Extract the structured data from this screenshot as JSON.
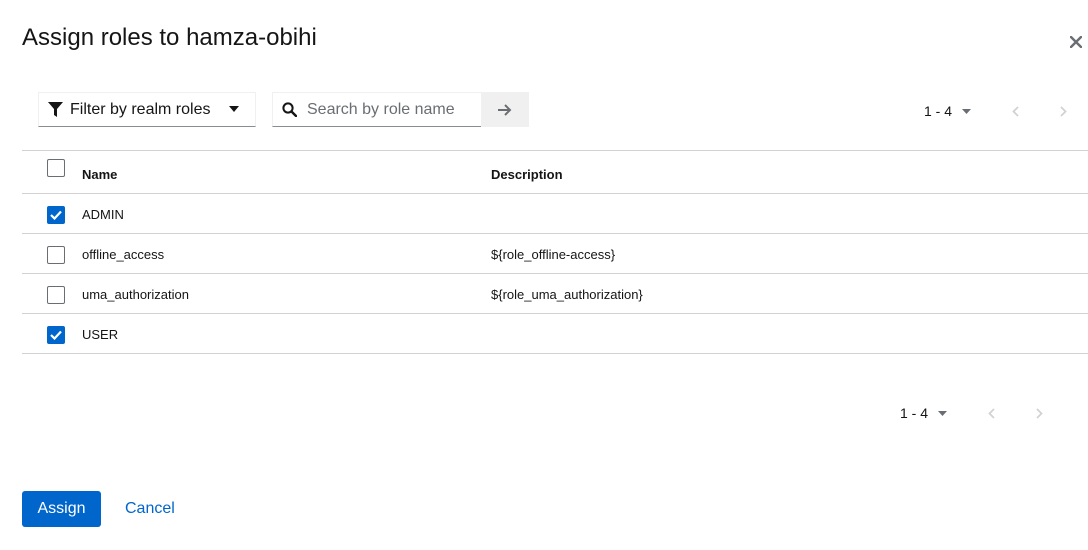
{
  "dialog": {
    "title": "Assign roles to hamza-obihi"
  },
  "toolbar": {
    "filter_label": "Filter by realm roles",
    "search_placeholder": "Search by role name",
    "search_value": ""
  },
  "pagination_top": {
    "range": "1 - 4"
  },
  "pagination_bottom": {
    "range": "1 - 4"
  },
  "table": {
    "columns": [
      "Name",
      "Description"
    ],
    "rows": [
      {
        "name": "ADMIN",
        "description": "",
        "checked": true
      },
      {
        "name": "offline_access",
        "description": "${role_offline-access}",
        "checked": false
      },
      {
        "name": "uma_authorization",
        "description": "${role_uma_authorization}",
        "checked": false
      },
      {
        "name": "USER",
        "description": "",
        "checked": true
      }
    ]
  },
  "footer": {
    "assign_label": "Assign",
    "cancel_label": "Cancel"
  },
  "colors": {
    "primary": "#0066cc",
    "border": "#d2d2d2"
  }
}
